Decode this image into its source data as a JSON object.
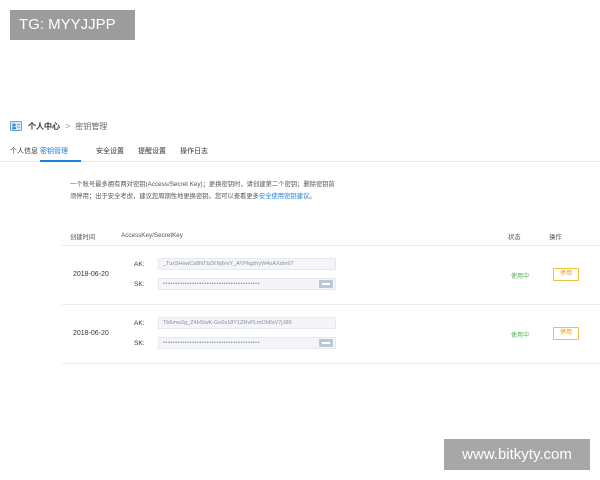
{
  "watermarks": {
    "top_left": "TG: MYYJJPP",
    "bottom_right": "www.bitkyty.com"
  },
  "breadcrumb": {
    "root": "个人中心",
    "separator": ">",
    "current": "密钥管理"
  },
  "tabs": [
    {
      "label": "个人信息",
      "active": false
    },
    {
      "label": "密钥管理",
      "active": true
    },
    {
      "label": "安全设置",
      "active": false
    },
    {
      "label": "提醒设置",
      "active": false
    },
    {
      "label": "操作日志",
      "active": false
    }
  ],
  "description": {
    "line1": "一个账号最多拥有两对密钥(Access/Secret Key)；更换密钥时，请创建第二个密钥；删除密钥前",
    "line2": "须停用；出于安全考虑，建议您周期性地更换密钥。您可以查看更多",
    "link": "安全使用密钥建议",
    "line2_end": "。"
  },
  "table": {
    "headers": {
      "created": "创建时间",
      "keys": "AccessKey/SecretKey",
      "status": "状态",
      "action": "操作"
    },
    "rows": [
      {
        "date": "2018-06-20",
        "ak_label": "AK:",
        "ak": "_TuxSHvwCs8NTbZKNj6rvY_AYPkgzhyW4oAXdm97",
        "sk_label": "SK:",
        "sk": "••••••••••••••••••••••••••••••••••••••••",
        "status": "使用中",
        "action": "停用"
      },
      {
        "date": "2018-06-20",
        "ak_label": "AK:",
        "ak": "Tb6mw2g_Z4bSlwK-Gn0x18Y1ZRvPLmOh8sV7jJ8K",
        "sk_label": "SK:",
        "sk": "••••••••••••••••••••••••••••••••••••••••",
        "status": "使用中",
        "action": "停用"
      }
    ]
  },
  "colors": {
    "accent": "#1b7fd6",
    "status_active": "#4caf50",
    "action_border": "#f0c040"
  }
}
